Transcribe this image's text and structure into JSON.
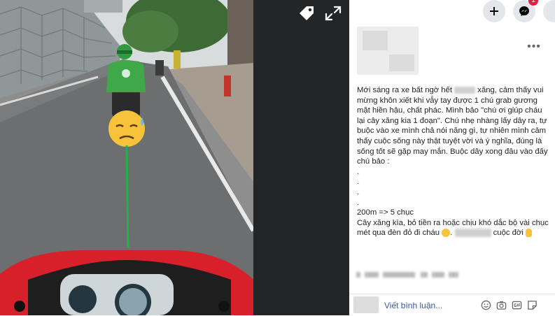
{
  "post": {
    "text_paragraphs": [
      "Mới sáng ra xe bất ngờ hết",
      "xăng, cảm thấy vui mừng khôn xiết khi vẫy tay được 1 chú grab gương mặt hiền hậu, chất phác. Mình bảo \"chú ơi giúp cháu lại cây xăng kia 1 đoạn\". Chú nhẹ nhàng lấy dây ra, tự buộc vào xe mình chả nói năng gì, tự nhiên mình cảm thấy cuộc sống này thật tuyệt vời và ý nghĩa, đúng là sống tốt sẽ gặp may mắn. Buộc dây xong đâu vào đấy chú bảo :"
    ],
    "dots": [
      ".",
      ".",
      ".",
      "."
    ],
    "price_line": "200m => 5 chục",
    "closing_text": "Cây xăng kìa, bỏ tiền ra hoặc chịu khó dắc bộ vài chục mét qua đèn đỏ đi cháu",
    "closing_suffix": "cuộc đời",
    "more_label": "•••"
  },
  "comment": {
    "placeholder": "Viết bình luận..."
  },
  "header": {
    "messenger_badge": "1"
  },
  "colors": {
    "photo_dark_strip": "#242526",
    "link_blue": "#385898",
    "badge_red": "#e41e3f",
    "tow_rope_green": "#22b24c",
    "grab_green": "#3fa94a",
    "scooter_red": "#d7202a"
  },
  "icons": [
    "tag-icon",
    "expand-icon",
    "plus-icon",
    "messenger-icon",
    "emoji-icon",
    "camera-icon",
    "gif-icon",
    "sticker-icon"
  ]
}
